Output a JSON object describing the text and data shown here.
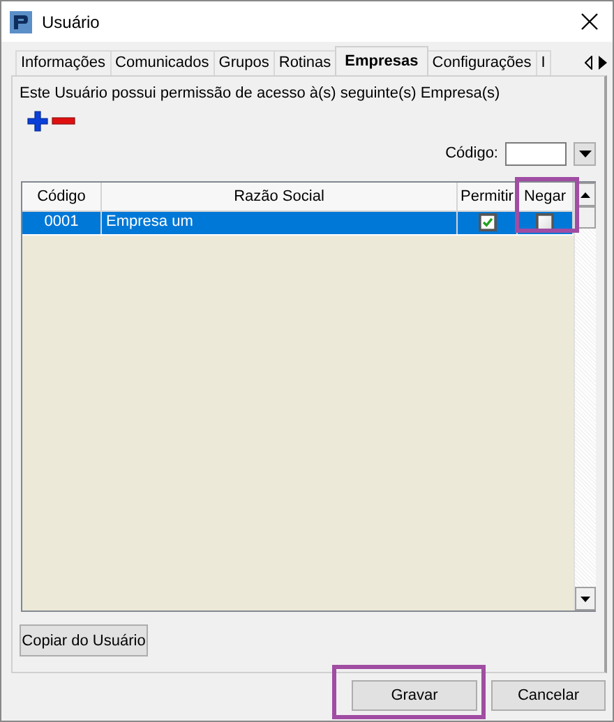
{
  "window": {
    "title": "Usuário"
  },
  "tabs": [
    {
      "label": "Informações",
      "selected": false
    },
    {
      "label": "Comunicados",
      "selected": false
    },
    {
      "label": "Grupos",
      "selected": false
    },
    {
      "label": "Rotinas",
      "selected": false
    },
    {
      "label": "Empresas",
      "selected": true
    },
    {
      "label": "Configurações",
      "selected": false
    },
    {
      "label": "I",
      "selected": false
    }
  ],
  "description": "Este Usuário possui permissão de acesso à(s) seguinte(s) Empresa(s)",
  "code_filter": {
    "label": "Código:"
  },
  "table": {
    "columns": [
      {
        "label": "Código",
        "highlighted": false
      },
      {
        "label": "Razão Social",
        "highlighted": false
      },
      {
        "label": "Permitir",
        "highlighted": false
      },
      {
        "label": "Negar",
        "highlighted": true
      }
    ],
    "rows": [
      {
        "code": "0001",
        "name": "Empresa um",
        "allow": true,
        "deny": false,
        "selected": true
      }
    ]
  },
  "copy_button": {
    "label": "Copiar do Usuário"
  },
  "buttons": [
    {
      "label": "Gravar",
      "highlighted": true
    },
    {
      "label": "Cancelar",
      "highlighted": false
    }
  ]
}
